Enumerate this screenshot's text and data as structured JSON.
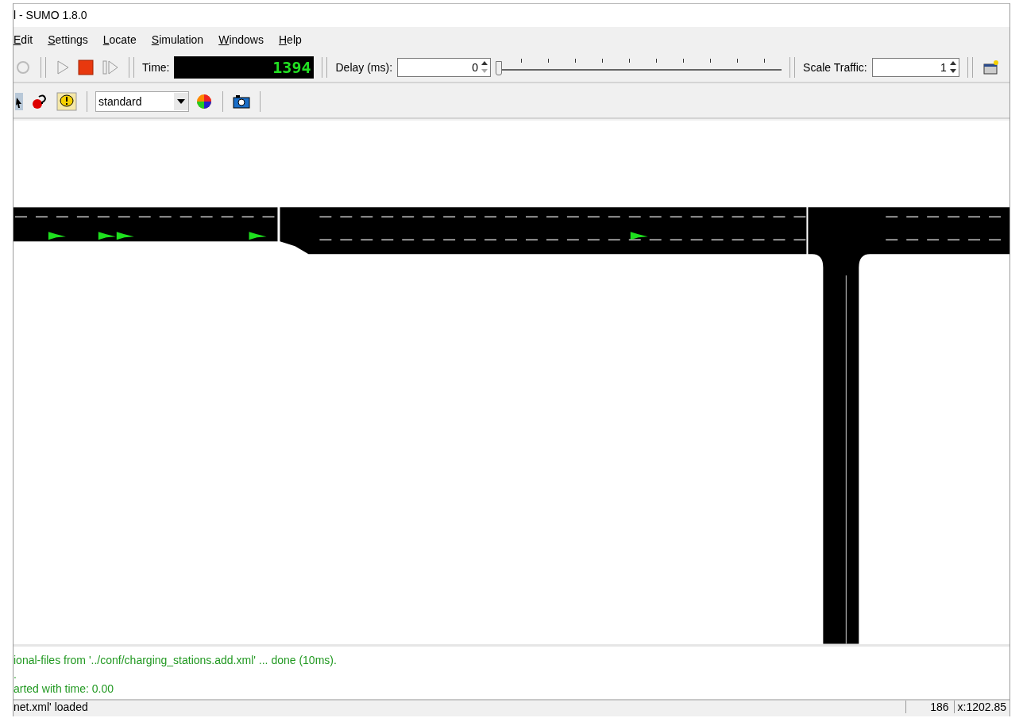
{
  "window": {
    "title": "l - SUMO 1.8.0"
  },
  "menu": [
    {
      "label": "Edit"
    },
    {
      "label": "Settings"
    },
    {
      "label": "Locate"
    },
    {
      "label": "Simulation"
    },
    {
      "label": "Windows"
    },
    {
      "label": "Help"
    }
  ],
  "toolbar": {
    "time_label": "Time:",
    "time_value": "1394",
    "delay_label": "Delay (ms):",
    "delay_value": "0",
    "delay_slider": {
      "level": 0.0
    },
    "scale_label": "Scale Traffic:",
    "scale_value": "1"
  },
  "view_toolbar": {
    "scheme": "standard"
  },
  "messages": [
    {
      "text": "ional-files from '../conf/charging_stations.add.xml' ... done (10ms)."
    },
    {
      "text": "."
    },
    {
      "text": "arted with time: 0.00"
    }
  ],
  "status_bar": {
    "message": "net.xml' loaded",
    "count": "186",
    "coords": "x:1202.85"
  }
}
